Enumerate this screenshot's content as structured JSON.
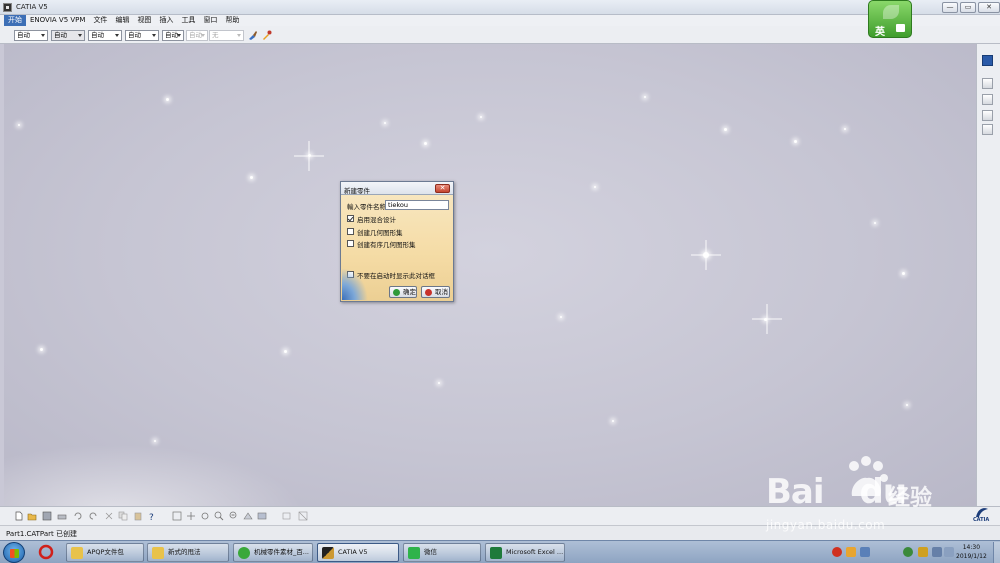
{
  "window": {
    "title": "CATIA V5",
    "controls": [
      "—",
      "▭",
      "✕"
    ]
  },
  "menu": {
    "items": [
      "开始",
      "ENOVIA V5 VPM",
      "文件",
      "编辑",
      "视图",
      "插入",
      "工具",
      "窗口",
      "帮助"
    ]
  },
  "toolbar": {
    "combos": [
      "自动",
      "自动",
      "自动",
      "自动",
      "自动",
      "自动",
      "无"
    ]
  },
  "ime": {
    "label": "英"
  },
  "dialog": {
    "title": "新建零件",
    "close_label": "✕",
    "name_label": "輸入零件名称",
    "name_value": "tiekou",
    "options": [
      {
        "label": "启用混合设计",
        "checked": true
      },
      {
        "label": "创建几何图形集",
        "checked": false
      },
      {
        "label": "创建有序几何图形集",
        "checked": false
      }
    ],
    "startup_option": {
      "label": "不要在启动时显示此对话框",
      "checked": false
    },
    "ok_label": "确定",
    "cancel_label": "取消"
  },
  "status": {
    "text": "Part1.CATPart 已创建"
  },
  "catia_logo": "CATIA",
  "taskbar": {
    "items": [
      {
        "label": "APQP文件包",
        "active": false
      },
      {
        "label": "新式的甩法",
        "active": false
      },
      {
        "label": "机械零件素材_百...",
        "active": false
      },
      {
        "label": "CATIA V5",
        "active": true
      },
      {
        "label": "微信",
        "active": false
      },
      {
        "label": "Microsoft Excel ...",
        "active": false
      }
    ],
    "clock_time": "14:30",
    "clock_date": "2019/1/12"
  },
  "watermark": {
    "brand": "Bai",
    "brand2": "du",
    "cn": "经验",
    "url": "jingyan.baidu.com"
  },
  "colors": {
    "menu_active": "#3d6fb6",
    "dialog_bg": "#f5dca6",
    "ime_green": "#3f9d2c"
  },
  "icons": {
    "toolbar": [
      "paintbrush-icon",
      "eyedropper-icon"
    ],
    "bottom": [
      "new-icon",
      "open-icon",
      "save-icon",
      "print-icon",
      "undo-icon",
      "redo-icon",
      "whatsthis-icon",
      "fit-all-icon",
      "pan-icon",
      "rotate-icon",
      "zoom-in-icon",
      "zoom-out-icon",
      "normal-view-icon",
      "render-style-icon",
      "hide-show-icon",
      "swap-visible-icon"
    ],
    "tray": [
      "sogou-icon",
      "network-icon",
      "volume-icon",
      "shield-icon",
      "flag-icon"
    ]
  }
}
